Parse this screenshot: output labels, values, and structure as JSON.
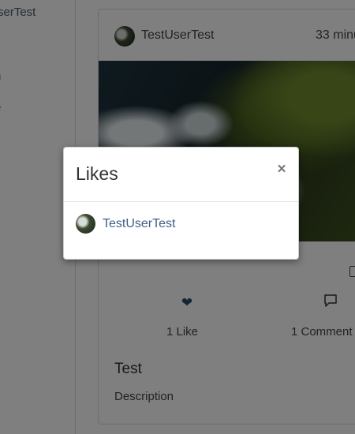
{
  "sidebar": {
    "items": [
      {
        "label": "serTest"
      },
      {
        "label": "n"
      },
      {
        "label": "e"
      },
      {
        "label": "t"
      }
    ]
  },
  "post": {
    "author": "TestUserTest",
    "time": "33 minu",
    "likes_label": "1 Like",
    "comments_label": "1 Comment",
    "title": "Test",
    "description": "Description",
    "like_icon": "heart-icon",
    "comment_icon": "comment-icon",
    "edit_icon": "edit-icon"
  },
  "modal": {
    "title": "Likes",
    "close_label": "×",
    "users": [
      {
        "name": "TestUserTest"
      }
    ]
  },
  "colors": {
    "backdrop": "rgba(0,0,0,0.5)",
    "link": "#3e5f86",
    "heart": "#2c4a6b"
  }
}
